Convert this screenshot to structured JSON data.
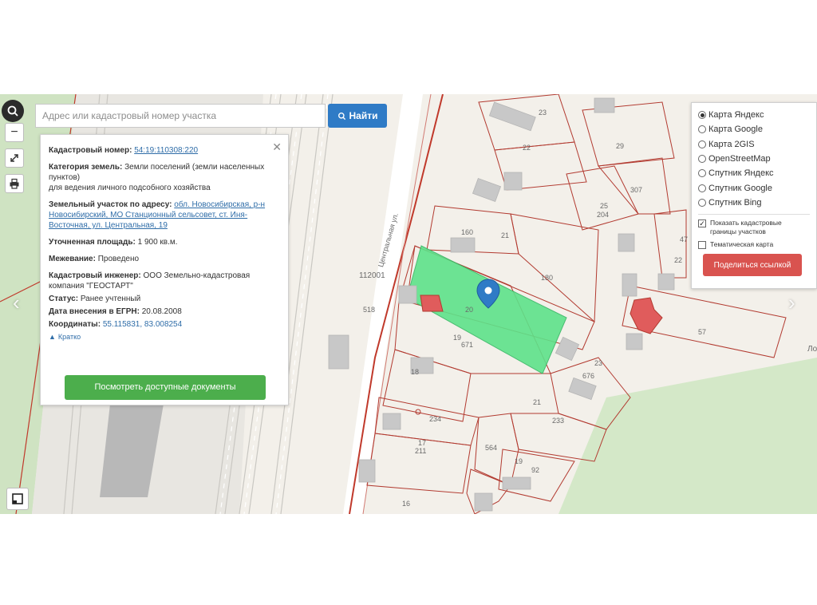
{
  "search": {
    "placeholder": "Адрес или кадастровый номер участка",
    "button_label": "Найти"
  },
  "controls": {
    "zoom_in": "+",
    "zoom_out": "−"
  },
  "info": {
    "cadastral_number_label": "Кадастровый номер:",
    "cadastral_number": "54:19:110308:220",
    "category_label": "Категория земель:",
    "category_value_1": "Земли поселений (земли населенных пунктов)",
    "category_value_2": "для ведения личного подсобного хозяйства",
    "address_label": "Земельный участок по адресу:",
    "address_value": "обл. Новосибирская, р-н Новосибирский, МО Станционный сельсовет, ст. Иня-Восточная, ул. Центральная, 19",
    "area_label": "Уточненная площадь:",
    "area_value": "1 900 кв.м.",
    "survey_label": "Межевание:",
    "survey_value": "Проведено",
    "engineer_label": "Кадастровый инженер:",
    "engineer_value": "ООО Земельно-кадастровая компания \"ГЕОСТАРТ\"",
    "status_label": "Статус:",
    "status_value": "Ранее учтенный",
    "egrn_date_label": "Дата внесения в ЕГРН:",
    "egrn_date_value": "20.08.2008",
    "coords_label": "Координаты:",
    "coords_value": "55.115831, 83.008254",
    "brief_link": "Кратко",
    "docs_button": "Посмотреть доступные документы"
  },
  "layers": {
    "base_maps": [
      {
        "label": "Карта Яндекс",
        "selected": true
      },
      {
        "label": "Карта Google",
        "selected": false
      },
      {
        "label": "Карта 2GIS",
        "selected": false
      },
      {
        "label": "OpenStreetMap",
        "selected": false
      },
      {
        "label": "Спутник Яндекс",
        "selected": false
      },
      {
        "label": "Спутник Google",
        "selected": false
      },
      {
        "label": "Спутник Bing",
        "selected": false
      }
    ],
    "show_cadastral": {
      "label": "Показать кадастровые границы участков",
      "checked": true
    },
    "thematic_map": {
      "label": "Тематическая карта",
      "checked": false
    },
    "share_button": "Поделиться ссылкой"
  },
  "map": {
    "street_name": "Центральная ул.",
    "quarter_number": "112001",
    "labels": [
      "23",
      "22",
      "29",
      "307",
      "25",
      "204",
      "160",
      "21",
      "180",
      "20",
      "57",
      "19",
      "671",
      "18",
      "23",
      "676",
      "21",
      "233",
      "234",
      "17",
      "211",
      "564",
      "19",
      "92",
      "16",
      "518",
      "22",
      "47",
      "Ло"
    ]
  },
  "colors": {
    "accent_blue": "#2f7bc6",
    "docs_green": "#4cae4c",
    "share_red": "#d9534f",
    "selected_parcel": "#5ee28a",
    "cadastral_border": "#c0392b"
  }
}
